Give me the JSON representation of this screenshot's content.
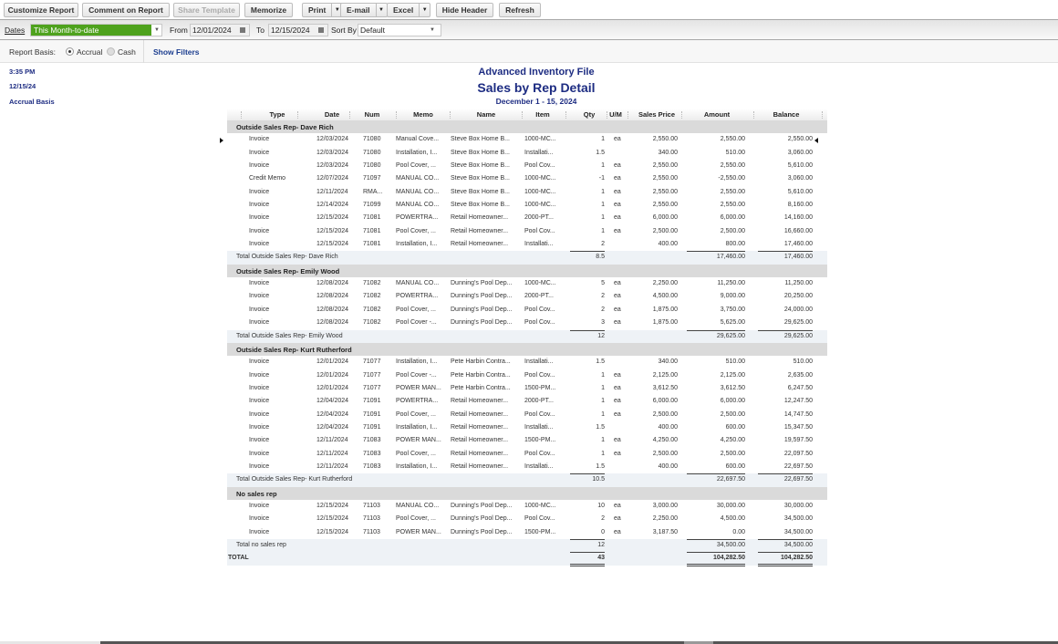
{
  "toolbar": {
    "customize": "Customize Report",
    "comment": "Comment on Report",
    "share": "Share Template",
    "memorize": "Memorize",
    "print": "Print",
    "email": "E-mail",
    "excel": "Excel",
    "hide_header": "Hide Header",
    "refresh": "Refresh",
    "dropdown_icon": "▼"
  },
  "filters": {
    "dates_label": "Dates",
    "dates_value": "This Month-to-date",
    "from_label": "From",
    "from_value": "12/01/2024",
    "to_label": "To",
    "to_value": "12/15/2024",
    "sort_label": "Sort By",
    "sort_value": "Default"
  },
  "basis": {
    "label": "Report Basis:",
    "accrual": "Accrual",
    "cash": "Cash",
    "selected": "Accrual",
    "show_filters": "Show Filters"
  },
  "meta": {
    "time": "3:35 PM",
    "date": "12/15/24",
    "basis": "Accrual Basis"
  },
  "report": {
    "company": "Advanced Inventory File",
    "title": "Sales by Rep Detail",
    "period": "December 1 - 15, 2024"
  },
  "columns": [
    "Type",
    "Date",
    "Num",
    "Memo",
    "Name",
    "Item",
    "Qty",
    "U/M",
    "Sales Price",
    "Amount",
    "Balance"
  ],
  "groups": [
    {
      "name": "Outside Sales Rep- Dave Rich",
      "rows": [
        [
          "Invoice",
          "12/03/2024",
          "71080",
          "Manual Cove...",
          "Steve Box Home B...",
          "1000-MC...",
          "1",
          "ea",
          "2,550.00",
          "2,550.00",
          "2,550.00"
        ],
        [
          "Invoice",
          "12/03/2024",
          "71080",
          "Installation, I...",
          "Steve Box Home B...",
          "Installati...",
          "1.5",
          "",
          "340.00",
          "510.00",
          "3,060.00"
        ],
        [
          "Invoice",
          "12/03/2024",
          "71080",
          "Pool Cover, ...",
          "Steve Box Home B...",
          "Pool Cov...",
          "1",
          "ea",
          "2,550.00",
          "2,550.00",
          "5,610.00"
        ],
        [
          "Credit Memo",
          "12/07/2024",
          "71097",
          "MANUAL CO...",
          "Steve Box Home B...",
          "1000-MC...",
          "-1",
          "ea",
          "2,550.00",
          "-2,550.00",
          "3,060.00"
        ],
        [
          "Invoice",
          "12/11/2024",
          "RMA...",
          "MANUAL CO...",
          "Steve Box Home B...",
          "1000-MC...",
          "1",
          "ea",
          "2,550.00",
          "2,550.00",
          "5,610.00"
        ],
        [
          "Invoice",
          "12/14/2024",
          "71099",
          "MANUAL CO...",
          "Steve Box Home B...",
          "1000-MC...",
          "1",
          "ea",
          "2,550.00",
          "2,550.00",
          "8,160.00"
        ],
        [
          "Invoice",
          "12/15/2024",
          "71081",
          "POWERTRA...",
          "Retail Homeowner...",
          "2000-PT...",
          "1",
          "ea",
          "6,000.00",
          "6,000.00",
          "14,160.00"
        ],
        [
          "Invoice",
          "12/15/2024",
          "71081",
          "Pool Cover, ...",
          "Retail Homeowner...",
          "Pool Cov...",
          "1",
          "ea",
          "2,500.00",
          "2,500.00",
          "16,660.00"
        ],
        [
          "Invoice",
          "12/15/2024",
          "71081",
          "Installation, I...",
          "Retail Homeowner...",
          "Installati...",
          "2",
          "",
          "400.00",
          "800.00",
          "17,460.00"
        ]
      ],
      "total_label": "Total Outside Sales Rep- Dave Rich",
      "total_qty": "8.5",
      "total_amount": "17,460.00",
      "total_balance": "17,460.00"
    },
    {
      "name": "Outside Sales Rep- Emily Wood",
      "rows": [
        [
          "Invoice",
          "12/08/2024",
          "71082",
          "MANUAL CO...",
          "Dunning's Pool Dep...",
          "1000-MC...",
          "5",
          "ea",
          "2,250.00",
          "11,250.00",
          "11,250.00"
        ],
        [
          "Invoice",
          "12/08/2024",
          "71082",
          "POWERTRA...",
          "Dunning's Pool Dep...",
          "2000-PT...",
          "2",
          "ea",
          "4,500.00",
          "9,000.00",
          "20,250.00"
        ],
        [
          "Invoice",
          "12/08/2024",
          "71082",
          "Pool Cover, ...",
          "Dunning's Pool Dep...",
          "Pool Cov...",
          "2",
          "ea",
          "1,875.00",
          "3,750.00",
          "24,000.00"
        ],
        [
          "Invoice",
          "12/08/2024",
          "71082",
          "Pool Cover -...",
          "Dunning's Pool Dep...",
          "Pool Cov...",
          "3",
          "ea",
          "1,875.00",
          "5,625.00",
          "29,625.00"
        ]
      ],
      "total_label": "Total Outside Sales Rep- Emily Wood",
      "total_qty": "12",
      "total_amount": "29,625.00",
      "total_balance": "29,625.00"
    },
    {
      "name": "Outside Sales Rep- Kurt Rutherford",
      "rows": [
        [
          "Invoice",
          "12/01/2024",
          "71077",
          "Installation, I...",
          "Pete Harbin Contra...",
          "Installati...",
          "1.5",
          "",
          "340.00",
          "510.00",
          "510.00"
        ],
        [
          "Invoice",
          "12/01/2024",
          "71077",
          "Pool Cover -...",
          "Pete Harbin Contra...",
          "Pool Cov...",
          "1",
          "ea",
          "2,125.00",
          "2,125.00",
          "2,635.00"
        ],
        [
          "Invoice",
          "12/01/2024",
          "71077",
          "POWER MAN...",
          "Pete Harbin Contra...",
          "1500-PM...",
          "1",
          "ea",
          "3,612.50",
          "3,612.50",
          "6,247.50"
        ],
        [
          "Invoice",
          "12/04/2024",
          "71091",
          "POWERTRA...",
          "Retail Homeowner...",
          "2000-PT...",
          "1",
          "ea",
          "6,000.00",
          "6,000.00",
          "12,247.50"
        ],
        [
          "Invoice",
          "12/04/2024",
          "71091",
          "Pool Cover, ...",
          "Retail Homeowner...",
          "Pool Cov...",
          "1",
          "ea",
          "2,500.00",
          "2,500.00",
          "14,747.50"
        ],
        [
          "Invoice",
          "12/04/2024",
          "71091",
          "Installation, I...",
          "Retail Homeowner...",
          "Installati...",
          "1.5",
          "",
          "400.00",
          "600.00",
          "15,347.50"
        ],
        [
          "Invoice",
          "12/11/2024",
          "71083",
          "POWER MAN...",
          "Retail Homeowner...",
          "1500-PM...",
          "1",
          "ea",
          "4,250.00",
          "4,250.00",
          "19,597.50"
        ],
        [
          "Invoice",
          "12/11/2024",
          "71083",
          "Pool Cover, ...",
          "Retail Homeowner...",
          "Pool Cov...",
          "1",
          "ea",
          "2,500.00",
          "2,500.00",
          "22,097.50"
        ],
        [
          "Invoice",
          "12/11/2024",
          "71083",
          "Installation, I...",
          "Retail Homeowner...",
          "Installati...",
          "1.5",
          "",
          "400.00",
          "600.00",
          "22,697.50"
        ]
      ],
      "total_label": "Total Outside Sales Rep- Kurt Rutherford",
      "total_qty": "10.5",
      "total_amount": "22,697.50",
      "total_balance": "22,697.50"
    },
    {
      "name": "No sales rep",
      "rows": [
        [
          "Invoice",
          "12/15/2024",
          "71103",
          "MANUAL CO...",
          "Dunning's Pool Dep...",
          "1000-MC...",
          "10",
          "ea",
          "3,000.00",
          "30,000.00",
          "30,000.00"
        ],
        [
          "Invoice",
          "12/15/2024",
          "71103",
          "Pool Cover, ...",
          "Dunning's Pool Dep...",
          "Pool Cov...",
          "2",
          "ea",
          "2,250.00",
          "4,500.00",
          "34,500.00"
        ],
        [
          "Invoice",
          "12/15/2024",
          "71103",
          "POWER MAN...",
          "Dunning's Pool Dep...",
          "1500-PM...",
          "0",
          "ea",
          "3,187.50",
          "0.00",
          "34,500.00"
        ]
      ],
      "total_label": "Total no sales rep",
      "total_qty": "12",
      "total_amount": "34,500.00",
      "total_balance": "34,500.00"
    }
  ],
  "grand_total": {
    "label": "TOTAL",
    "qty": "43",
    "amount": "104,282.50",
    "balance": "104,282.50"
  }
}
